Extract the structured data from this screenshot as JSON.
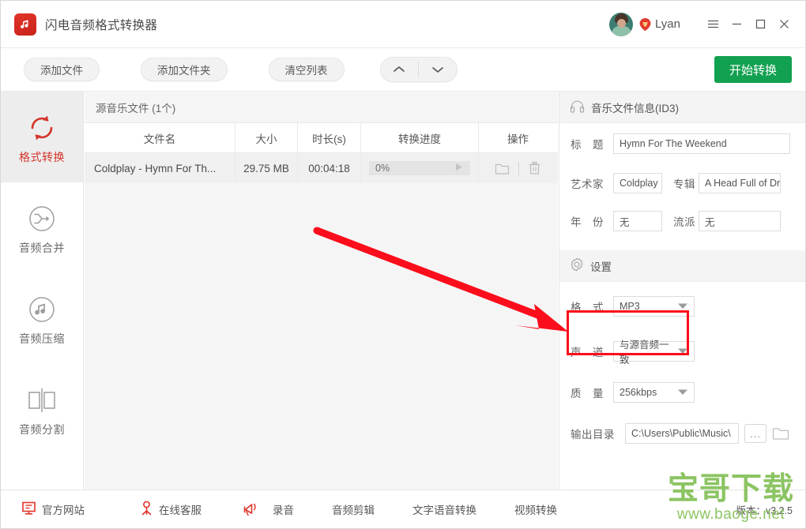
{
  "window": {
    "app_title": "闪电音频格式转换器",
    "logo_icon": "music-note-icon",
    "user_name": "Lyan",
    "vip_badge_icon": "vip-badge-icon",
    "avatar_icon": "user-avatar",
    "menu_icon": "hamburger-menu-icon",
    "minimize_icon": "minimize-icon",
    "maximize_icon": "maximize-icon",
    "close_icon": "close-icon"
  },
  "toolbar": {
    "add_file": "添加文件",
    "add_folder": "添加文件夹",
    "clear_list": "清空列表",
    "move_up_icon": "chevron-up-icon",
    "move_down_icon": "chevron-down-icon",
    "start_convert": "开始转换",
    "start_convert_color": "#12a150"
  },
  "sidebar": {
    "items": [
      {
        "label": "格式转换",
        "icon": "convert-arrows-icon",
        "active": true
      },
      {
        "label": "音频合并",
        "icon": "merge-arrows-icon",
        "active": false
      },
      {
        "label": "音频压缩",
        "icon": "music-note-circle-icon",
        "active": false
      },
      {
        "label": "音频分割",
        "icon": "split-squares-icon",
        "active": false
      }
    ],
    "active_color": "#d4342a"
  },
  "filelist": {
    "header": "源音乐文件 (1个)",
    "columns": [
      "文件名",
      "大小",
      "时长(s)",
      "转换进度",
      "操作"
    ],
    "rows": [
      {
        "name": "Coldplay - Hymn For Th...",
        "size": "29.75 MB",
        "duration": "00:04:18",
        "progress": "0%",
        "play_icon": "play-icon",
        "folder_icon": "folder-icon",
        "delete_icon": "trash-icon"
      }
    ]
  },
  "id3_panel": {
    "title": "音乐文件信息(ID3)",
    "icon": "headphones-icon",
    "fields": {
      "title_label": "标　题",
      "title_value": "Hymn For The Weekend",
      "artist_label": "艺术家",
      "artist_value": "Coldplay",
      "album_label": "专辑",
      "album_value": "A Head Full of Dreams",
      "year_label": "年　份",
      "year_value": "无",
      "genre_label": "流派",
      "genre_value": "无"
    }
  },
  "settings_panel": {
    "title": "设置",
    "icon": "gear-icon",
    "format_label": "格　式",
    "format_value": "MP3",
    "channel_label": "声　道",
    "channel_value": "与源音频一致",
    "quality_label": "质　量",
    "quality_value": "256kbps",
    "output_label": "输出目录",
    "output_value": "C:\\Users\\Public\\Music\\",
    "browse_button": "...",
    "open_folder_icon": "folder-open-icon",
    "dropdown_icon": "caret-down-icon"
  },
  "statusbar": {
    "website": "官方网站",
    "website_icon": "monitor-icon",
    "support": "在线客服",
    "support_icon": "person-icon",
    "record_icon": "megaphone-icon",
    "record": "录音",
    "audio_edit": "音频剪辑",
    "tts": "文字语音转换",
    "video_convert": "视频转换",
    "version": "版本：v3.2.5"
  },
  "annotations": {
    "arrow_color": "#fc0d1b",
    "box_color": "#fc0d1b",
    "watermark_main": "宝哥下载",
    "watermark_sub": "www.baoge.net",
    "watermark_color": "#8cc463"
  }
}
